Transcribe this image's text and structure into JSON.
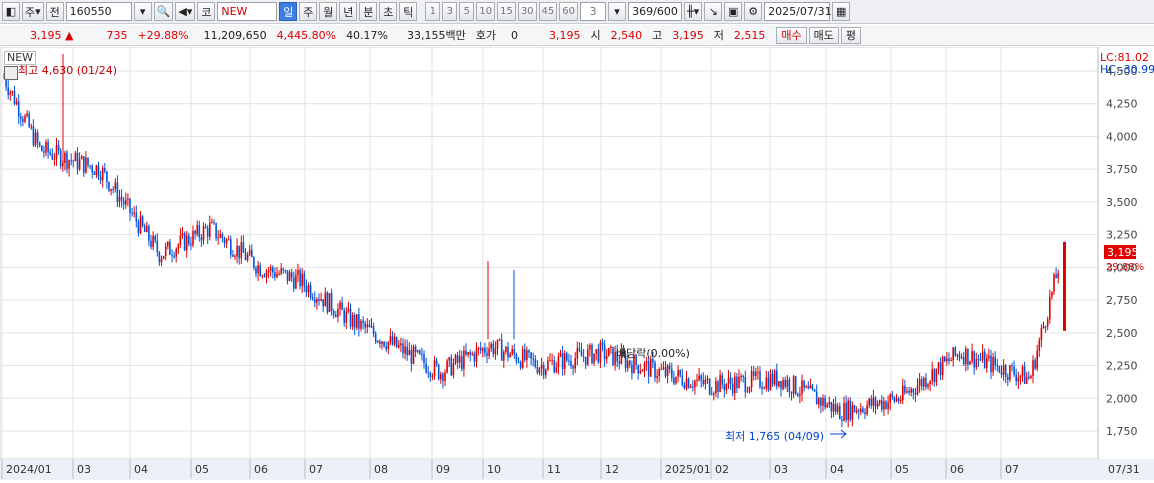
{
  "toolbar": {
    "period_label": "주",
    "prev_label": "전",
    "code": "160550",
    "market_label": "코",
    "name_input": "NEW",
    "periods": [
      "일",
      "주",
      "월",
      "년",
      "분",
      "초",
      "틱"
    ],
    "active_period": "일",
    "intervals": [
      "1",
      "3",
      "5",
      "10",
      "15",
      "30",
      "45",
      "60"
    ],
    "interval_value": "3",
    "count": "369/600",
    "date": "2025/07/31"
  },
  "quote": {
    "price": "3,195",
    "change": "735",
    "change_pct": "+29.88%",
    "volume": "11,209,650",
    "volume_pct": "4,445.80%",
    "turnover": "40.17%",
    "amount": "33,155백만",
    "hoga_label": "호가",
    "hoga_value": "0",
    "hoga_price": "3,195",
    "open_label": "시",
    "open": "2,540",
    "high_label": "고",
    "high": "3,195",
    "low_label": "저",
    "low": "2,515",
    "buy_label": "매수",
    "sell_label": "매도",
    "avg_label": "평"
  },
  "chart": {
    "name_tag": "NEW",
    "lc_label": "LC:81.02",
    "hc_label": "HC:-30.99",
    "high_annotation": "최고 4,630 (01/24)",
    "low_annotation": "최저 1,765 (04/09)",
    "dividend_annotation": "배당락(0.00%)",
    "current_price_tag": "3,195",
    "current_pct_tag": "29.88%",
    "y_ticks": [
      "4,500",
      "4,250",
      "4,000",
      "3,750",
      "3,500",
      "3,250",
      "3,000",
      "2,750",
      "2,500",
      "2,250",
      "2,000",
      "1,750"
    ],
    "x_ticks": [
      "2024/01",
      "03",
      "04",
      "05",
      "06",
      "07",
      "08",
      "09",
      "10",
      "11",
      "12",
      "2025/01",
      "02",
      "03",
      "04",
      "05",
      "06",
      "07"
    ],
    "x_end_label": "07/31",
    "colors": {
      "up": "#e00000",
      "down": "#0055dd",
      "grid": "#e3e3e3"
    }
  },
  "chart_data": {
    "type": "candlestick",
    "ylim": [
      1650,
      4650
    ],
    "title": "",
    "series": [
      {
        "name": "",
        "x": [
          "2024-01",
          "2024-02",
          "2024-03",
          "2024-04",
          "2024-05",
          "2024-06",
          "2024-07",
          "2024-08",
          "2024-09",
          "2024-10",
          "2024-11",
          "2024-12",
          "2025-01",
          "2025-02",
          "2025-03",
          "2025-04",
          "2025-05",
          "2025-06",
          "2025-07",
          "2025-07-31"
        ],
        "close": [
          4450,
          3900,
          3750,
          3100,
          3300,
          3000,
          2900,
          2600,
          2200,
          2400,
          2250,
          2350,
          2200,
          2100,
          2150,
          1900,
          2000,
          2350,
          2150,
          3195
        ]
      }
    ],
    "annotations": [
      {
        "label": "최고",
        "value": 4630,
        "date": "01/24"
      },
      {
        "label": "최저",
        "value": 1765,
        "date": "04/09"
      }
    ]
  }
}
